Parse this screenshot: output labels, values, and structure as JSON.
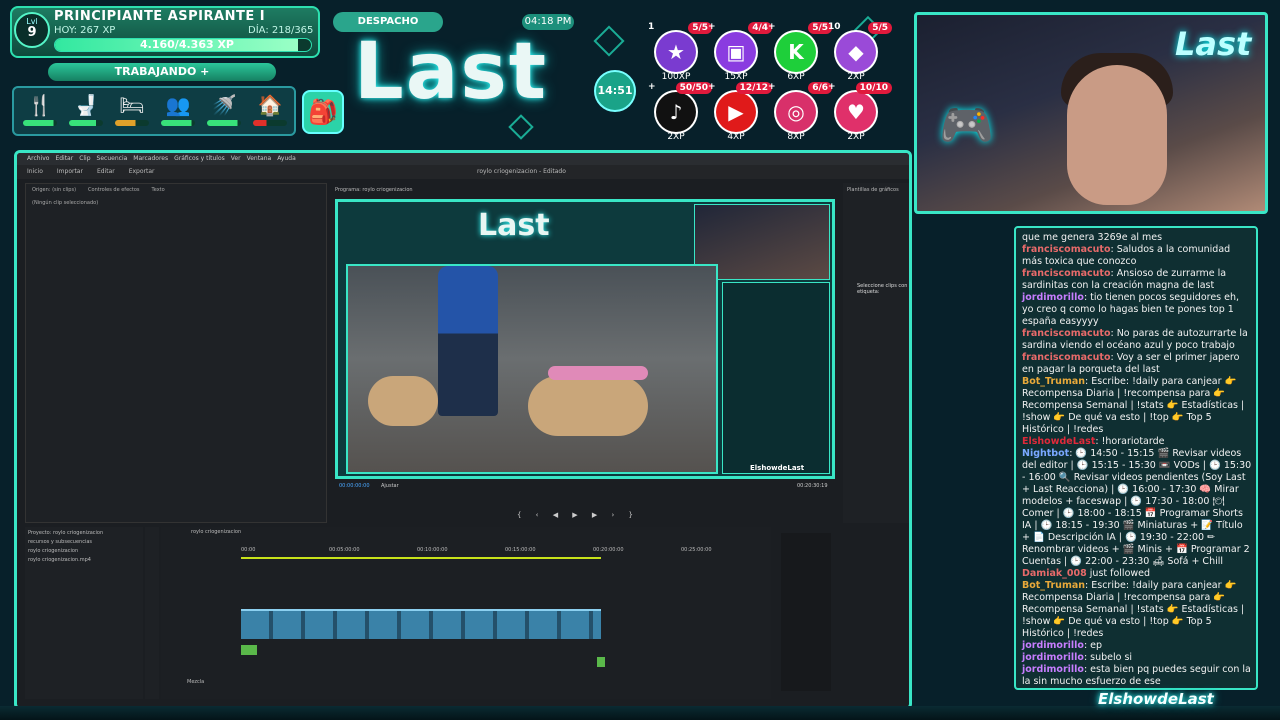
{
  "overlay": {
    "level_label": "Lvl",
    "level": "9",
    "rank_title": "PRINCIPIANTE ASPIRANTE I",
    "today_xp": "HOY: 267 XP",
    "day_count": "DÍA: 218/365",
    "xp_text": "4.160/4.363 XP",
    "xp_progress": 0.95,
    "status_button": "TRABAJANDO +",
    "despacho": "DESPACHO",
    "clock": "04:18 PM",
    "title": "Last",
    "timer": "14:51",
    "needs": [
      {
        "icon": "fork-knife-icon",
        "glyph": "🍴",
        "level": 0.9,
        "color": "#38e27a"
      },
      {
        "icon": "toilet-icon",
        "glyph": "🚽",
        "level": 0.8,
        "color": "#38e27a"
      },
      {
        "icon": "bed-icon",
        "glyph": "🛏",
        "level": 0.6,
        "color": "#e0a12a"
      },
      {
        "icon": "people-icon",
        "glyph": "👥",
        "level": 0.9,
        "color": "#38e27a"
      },
      {
        "icon": "shower-icon",
        "glyph": "🚿",
        "level": 0.9,
        "color": "#38e27a"
      },
      {
        "icon": "house-icon",
        "glyph": "🏠",
        "level": 0.4,
        "color": "#e0302a"
      }
    ],
    "socials": [
      {
        "icon": "star-icon",
        "glyph": "★",
        "color": "#7a3bd0",
        "count": "5/5",
        "level": "1",
        "xp": "100XP"
      },
      {
        "icon": "twitch-icon",
        "glyph": "▣",
        "color": "#8a3ce0",
        "count": "4/4",
        "level": "+",
        "xp": "15XP"
      },
      {
        "icon": "kick-icon",
        "glyph": "K",
        "color": "#1ecf3a",
        "count": "5/5",
        "level": "+",
        "xp": "6XP"
      },
      {
        "icon": "crystal-icon",
        "glyph": "◆",
        "color": "#9a4ad8",
        "count": "5/5",
        "level": "10",
        "xp": "2XP"
      },
      {
        "icon": "tiktok-icon",
        "glyph": "♪",
        "color": "#111111",
        "count": "50/50",
        "level": "+",
        "xp": "2XP"
      },
      {
        "icon": "youtube-icon",
        "glyph": "▶",
        "color": "#e01a1a",
        "count": "12/12",
        "level": "+",
        "xp": "4XP"
      },
      {
        "icon": "instagram-icon",
        "glyph": "◎",
        "color": "#d8306a",
        "count": "6/6",
        "level": "+",
        "xp": "8XP"
      },
      {
        "icon": "podcast-icon",
        "glyph": "♥",
        "color": "#e0306a",
        "count": "10/10",
        "level": "+",
        "xp": "2XP"
      }
    ],
    "handle": "ElshowdeLast"
  },
  "premiere": {
    "menu": [
      "Archivo",
      "Editar",
      "Clip",
      "Secuencia",
      "Marcadores",
      "Gráficos y títulos",
      "Ver",
      "Ventana",
      "Ayuda"
    ],
    "tabs": [
      "Inicio",
      "Importar",
      "Editar",
      "Exportar"
    ],
    "window_title": "roylo criogenizacion - Editado",
    "source_tabs": [
      "Origen: (sin clips)",
      "Controles de efectos",
      "Texto"
    ],
    "source_empty": "(Ningún clip seleccionado)",
    "program_label": "Programa: roylo criogenizacion",
    "timecode_left": "00:00:00:00",
    "fit": "Ajustar",
    "timecode_right": "00:20:30:19",
    "transport": "{ ‹ ◀ ▶ ▶ › }",
    "right_panel_title": "Plantillas de gráficos",
    "selected_clips_text": "Seleccione clips con etiqueta:",
    "project_title": "Proyecto: roylo criogenizacion",
    "project_items": [
      "recursos y subsecuencias",
      "roylo criogenizacion",
      "roylo criogenizacion.mp4"
    ],
    "timeline_tab": "roylo criogenizacion",
    "ruler": [
      "00:00",
      "00:05:00:00",
      "00:10:00:00",
      "00:15:00:00",
      "00:20:00:00",
      "00:25:00:00"
    ],
    "mix_label": "Mezcla",
    "mini_chat_handle": "ElshowdeLast",
    "mini_title": "Last"
  },
  "chat": [
    {
      "user": "",
      "color": "#ffffff",
      "text": "que me genera 3269e al mes"
    },
    {
      "user": "franciscomacuto",
      "color": "#e86a6a",
      "text": ": Saludos a la comunidad más toxica que conozco"
    },
    {
      "user": "franciscomacuto",
      "color": "#e86a6a",
      "text": ": Ansioso de zurrarme la sardinitas con la creación magna de last"
    },
    {
      "user": "jordimorillo",
      "color": "#c77dff",
      "text": ": tio tienen pocos seguidores eh, yo creo q como lo hagas bien te pones top 1 españa easyyyy"
    },
    {
      "user": "franciscomacuto",
      "color": "#e86a6a",
      "text": ": No paras de autozurrarte la sardina viendo el océano azul y poco trabajo"
    },
    {
      "user": "franciscomacuto",
      "color": "#e86a6a",
      "text": ": Voy a ser el primer japero en pagar la porqueta del last"
    },
    {
      "user": "Bot_Truman",
      "color": "#e8a93a",
      "text": ": Escribe: !daily para canjear 👉 Recompensa Diaria | !recompensa para 👉 Recompensa Semanal | !stats 👉 Estadísticas | !show 👉 De qué va esto | !top 👉 Top 5 Histórico | !redes"
    },
    {
      "user": "ElshowdeLast",
      "color": "#e02a3a",
      "text": ": !horariotarde"
    },
    {
      "user": "Nightbot",
      "color": "#7aa8ff",
      "text": ": 🕒 14:50 - 15:15 🎬 Revisar videos del editor | 🕒 15:15 - 15:30 📼 VODs | 🕒 15:30 - 16:00 🔍 Revisar videos pendientes (Soy Last + Last Reacciona) | 🕒 16:00 - 17:30 🧠 Mirar modelos + faceswap | 🕒 17:30 - 18:00 🍽 Comer | 🕒 18:00 - 18:15 📅 Programar Shorts IA | 🕒 18:15 - 19:30 🎬 Miniaturas + 📝 Título + 📄 Descripción IA | 🕒 19:30 - 22:00 ✏ Renombrar videos + 🎬 Minis + 📅 Programar 2 Cuentas | 🕒 22:00 - 23:30 🛋 Sofá + Chill"
    },
    {
      "user": "Damiak_008",
      "color": "#e86a6a",
      "text": " just followed"
    },
    {
      "user": "Bot_Truman",
      "color": "#e8a93a",
      "text": ": Escribe: !daily para canjear 👉 Recompensa Diaria | !recompensa para 👉 Recompensa Semanal | !stats 👉 Estadísticas | !show 👉 De qué va esto | !top 👉 Top 5 Histórico | !redes"
    },
    {
      "user": "jordimorillo",
      "color": "#c77dff",
      "text": ": ep"
    },
    {
      "user": "jordimorillo",
      "color": "#c77dff",
      "text": ": subelo si"
    },
    {
      "user": "jordimorillo",
      "color": "#c77dff",
      "text": ": esta bien pq puedes seguir con la la sin mucho esfuerzo de ese"
    }
  ]
}
